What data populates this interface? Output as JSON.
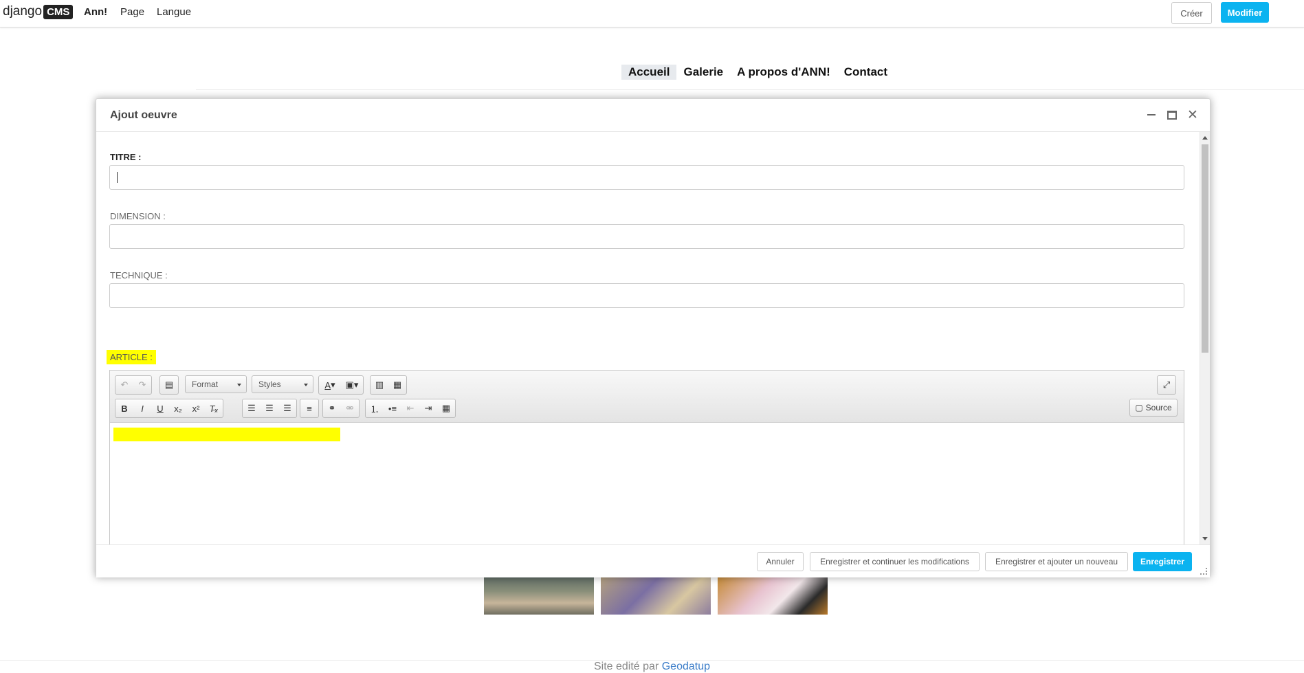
{
  "toolbar": {
    "logo_text": "django",
    "logo_badge": "CMS",
    "site_name": "Ann!",
    "menu_page": "Page",
    "menu_langue": "Langue",
    "btn_creer": "Créer",
    "btn_modifier": "Modifier",
    "accent_color": "#0bb3f0"
  },
  "site_nav": {
    "items": [
      "Accueil",
      "Galerie",
      "A propos d'ANN!",
      "Contact"
    ],
    "active": "Accueil"
  },
  "modal": {
    "title": "Ajout oeuvre",
    "fields": {
      "titre_label": "TITRE :",
      "titre_value": "",
      "dimension_label": "DIMENSION :",
      "dimension_value": "",
      "technique_label": "TECHNIQUE :",
      "technique_value": "",
      "article_label": "ARTICLE :"
    },
    "editor": {
      "format_combo": "Format",
      "styles_combo": "Styles",
      "source_label": "Source",
      "icons": [
        "undo-icon",
        "redo-icon",
        "paste-from-word-icon",
        "text-color-icon",
        "background-color-icon",
        "paste-text-icon",
        "paste-icon",
        "maximize-icon",
        "bold-icon",
        "italic-icon",
        "underline-icon",
        "subscript-icon",
        "superscript-icon",
        "remove-format-icon",
        "align-left-icon",
        "align-center-icon",
        "align-right-icon",
        "horizontal-rule-icon",
        "link-icon",
        "unlink-icon",
        "numbered-list-icon",
        "bulleted-list-icon",
        "outdent-icon",
        "indent-icon",
        "table-icon",
        "source-icon"
      ],
      "highlight_color": "#ffff00"
    },
    "buttons": {
      "annuler": "Annuler",
      "save_continue": "Enregistrer et continuer les modifications",
      "save_add": "Enregistrer et ajouter un nouveau",
      "save": "Enregistrer"
    }
  },
  "footer": {
    "text": "Site edité par",
    "link": "Geodatup"
  }
}
